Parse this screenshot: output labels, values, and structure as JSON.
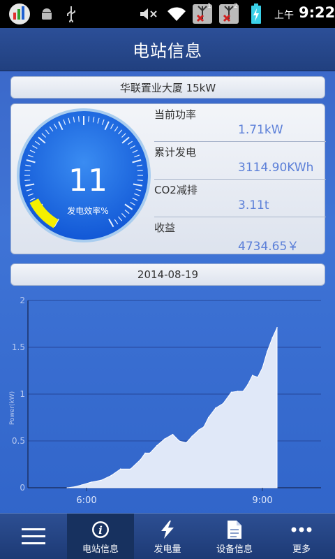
{
  "status_bar": {
    "time_prefix": "上午",
    "time": "9:22",
    "sim1_number": "1",
    "sim2_number": "2"
  },
  "header": {
    "title": "电站信息"
  },
  "station": {
    "name": "华联置业大厦 15kW"
  },
  "gauge": {
    "value": "11",
    "label": "发电效率%",
    "percent": 11
  },
  "metrics": [
    {
      "label": "当前功率",
      "value": "1.71kW"
    },
    {
      "label": "累计发电",
      "value": "3114.90KWh"
    },
    {
      "label": "CO2减排",
      "value": "3.11t"
    },
    {
      "label": "收益",
      "value": "4734.65￥"
    }
  ],
  "date": "2014-08-19",
  "chart_data": {
    "type": "area",
    "ylabel": "Power(kW)",
    "ylim": [
      0,
      2
    ],
    "yticks": [
      "0",
      "0.5",
      "1",
      "1.5",
      "2"
    ],
    "xticks": [
      {
        "label": "6:00",
        "t": 6.0
      },
      {
        "label": "9:00",
        "t": 9.0
      }
    ],
    "xlim": [
      5.0,
      10.0
    ],
    "grid": true,
    "x": [
      "5:40",
      "5:48",
      "5:55",
      "6:05",
      "6:15",
      "6:25",
      "6:35",
      "6:45",
      "6:55",
      "7:00",
      "7:05",
      "7:12",
      "7:20",
      "7:28",
      "7:35",
      "7:42",
      "7:48",
      "7:55",
      "8:00",
      "8:05",
      "8:12",
      "8:20",
      "8:28",
      "8:35",
      "8:40",
      "8:45",
      "8:50",
      "8:55",
      "9:00",
      "9:05",
      "9:10",
      "9:15"
    ],
    "t": [
      5.67,
      5.8,
      5.92,
      6.08,
      6.25,
      6.42,
      6.58,
      6.75,
      6.92,
      7.0,
      7.08,
      7.2,
      7.33,
      7.47,
      7.58,
      7.7,
      7.8,
      7.92,
      8.0,
      8.08,
      8.2,
      8.33,
      8.47,
      8.58,
      8.67,
      8.75,
      8.83,
      8.92,
      9.0,
      9.08,
      9.17,
      9.25
    ],
    "values": [
      0.0,
      0.01,
      0.03,
      0.06,
      0.08,
      0.13,
      0.2,
      0.2,
      0.3,
      0.37,
      0.37,
      0.45,
      0.52,
      0.57,
      0.5,
      0.48,
      0.55,
      0.62,
      0.65,
      0.75,
      0.85,
      0.9,
      1.02,
      1.03,
      1.03,
      1.1,
      1.2,
      1.18,
      1.28,
      1.45,
      1.6,
      1.71
    ]
  },
  "nav": [
    {
      "label": "",
      "icon": "menu-icon"
    },
    {
      "label": "电站信息",
      "icon": "info-icon"
    },
    {
      "label": "发电量",
      "icon": "lightning-icon"
    },
    {
      "label": "设备信息",
      "icon": "document-icon"
    },
    {
      "label": "更多",
      "icon": "more-icon"
    }
  ],
  "colors": {
    "accent": "#5b7fd8",
    "gauge_fill": "#f5ef00",
    "chart_fill": "#e0e8f8"
  }
}
